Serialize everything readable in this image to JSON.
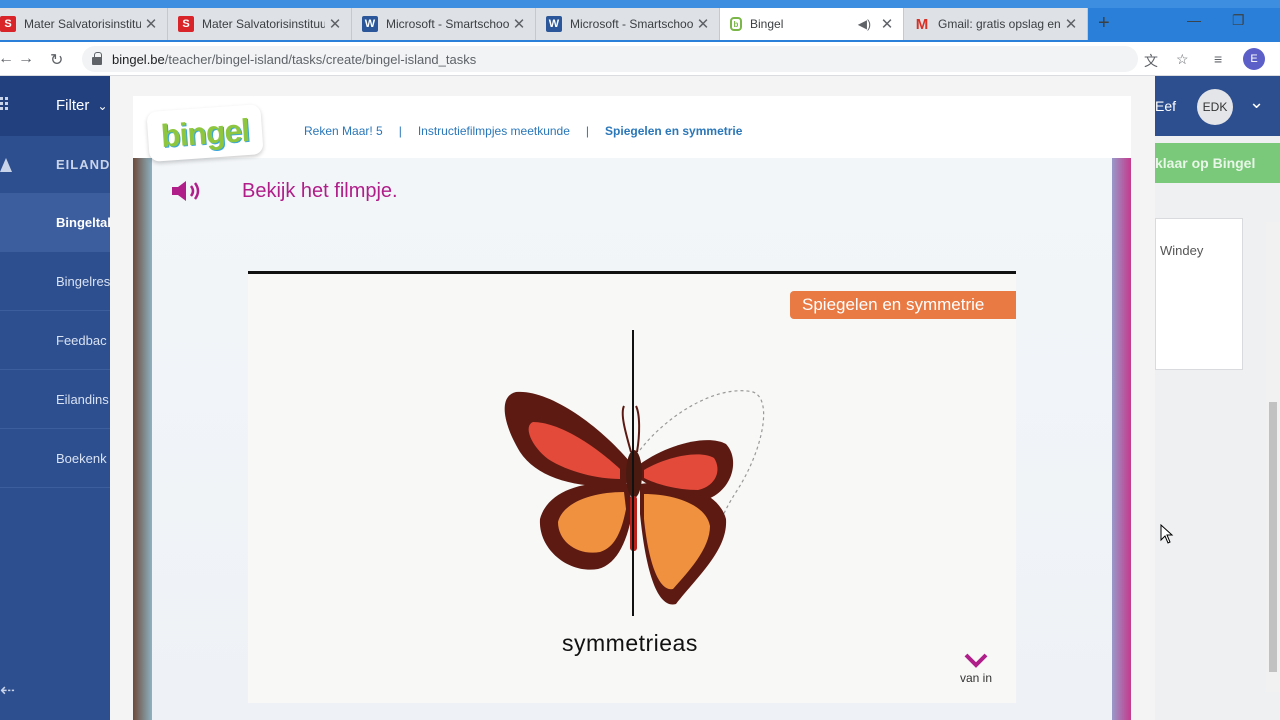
{
  "browser": {
    "tabs": [
      {
        "icon": "smartschool",
        "title": "Mater Salvatorisinstituut",
        "close": "✕"
      },
      {
        "icon": "smartschool",
        "title": "Mater Salvatorisinstituut",
        "close": "✕"
      },
      {
        "icon": "word",
        "title": "Microsoft - Smartschool",
        "close": "✕"
      },
      {
        "icon": "word",
        "title": "Microsoft - Smartschool",
        "close": "✕"
      },
      {
        "icon": "bingel",
        "title": "Bingel",
        "close": "✕",
        "active": true,
        "audio": true
      },
      {
        "icon": "gmail",
        "title": "Gmail: gratis opslag en",
        "close": "✕"
      }
    ],
    "new_tab": "+",
    "url_host": "bingel.be",
    "url_path": "/teacher/bingel-island/tasks/create/bingel-island_tasks",
    "profile_letter": "E"
  },
  "app": {
    "filter_label": "Filter",
    "sidebar": {
      "header": "EILAND",
      "items": [
        {
          "label": "Bingeltak",
          "active": true
        },
        {
          "label": "Bingelres"
        },
        {
          "label": "Feedbac"
        },
        {
          "label": "Eilandins"
        },
        {
          "label": "Boekenk"
        }
      ]
    },
    "user_name_fragment": "Eef",
    "user_initials": "EDK",
    "green_button": "klaar op Bingel",
    "panel_text": "Windey"
  },
  "modal": {
    "close": "✕",
    "logo_text": "bingel",
    "breadcrumbs": [
      "Reken Maar! 5",
      "Instructiefilmpjes meetkunde",
      "Spiegelen en symmetrie"
    ],
    "separator": "|",
    "instruction": "Bekijk het filmpje.",
    "video": {
      "title_badge": "Spiegelen en symmetrie",
      "axis_label": "symmetrieas",
      "publisher": "van in"
    }
  },
  "colors": {
    "instruction": "#b01e8a",
    "badge": "#ea7a43",
    "breadcrumb": "#2a77b9",
    "sidebar": "#2e4f8f"
  }
}
